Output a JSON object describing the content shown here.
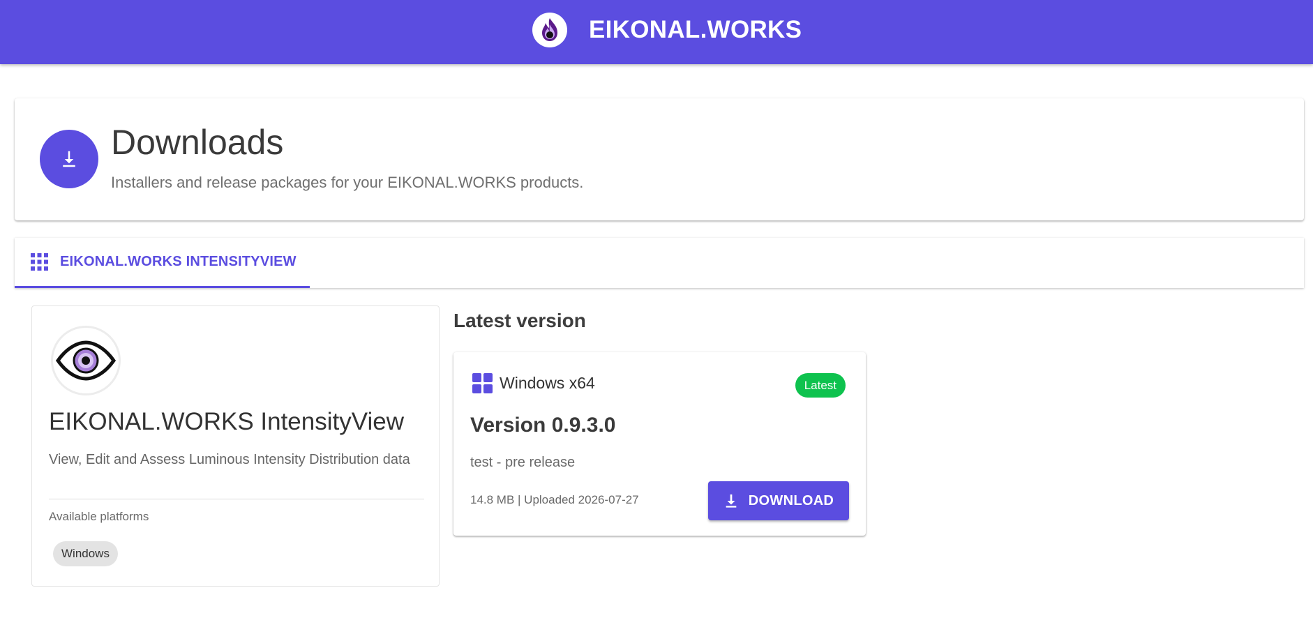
{
  "app": {
    "brand_name": "EIKONAL.WORKS",
    "brand_icon": "flame-logo-icon",
    "accent_color": "#5b4de0"
  },
  "header": {
    "title": "Downloads",
    "subtitle": "Installers and release packages for your EIKONAL.WORKS products.",
    "icon": "download-icon"
  },
  "tabs": [
    {
      "label": "EIKONAL.WORKS INTENSITYVIEW",
      "icon": "apps-grid-icon",
      "active": true
    }
  ],
  "product": {
    "name": "EIKONAL.WORKS IntensityView",
    "description": "View, Edit and Assess Luminous Intensity Distribution data",
    "platforms_label": "Available platforms",
    "platforms": [
      "Windows"
    ],
    "logo_icon": "eye-logo-icon"
  },
  "latest": {
    "section_title": "Latest version",
    "platform": "Windows x64",
    "platform_icon": "windows-icon",
    "badge": "Latest",
    "badge_color": "#0ec24e",
    "version": "Version 0.9.3.0",
    "note": "test - pre release",
    "meta": "14.8 MB | Uploaded 2026-07-27",
    "download_label": "DOWNLOAD"
  }
}
